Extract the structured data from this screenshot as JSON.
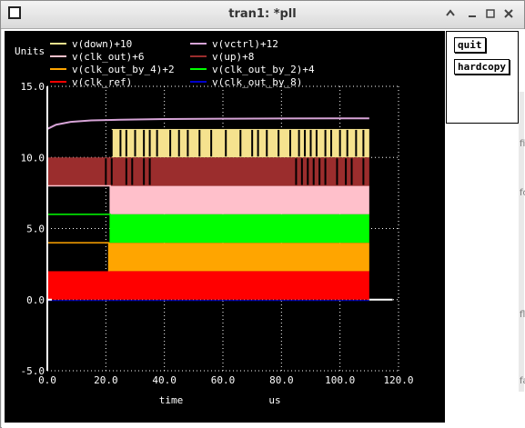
{
  "window": {
    "title": "tran1: *pll"
  },
  "side_buttons": {
    "quit": "quit",
    "hardcopy": "hardcopy"
  },
  "edge_labels": [
    "fi",
    "fo",
    "fl",
    "fa"
  ],
  "colors": {
    "down": "#f5e28e",
    "vctrl": "#d7a4d7",
    "clk_out": "#ffc0cb",
    "up": "#9b2d2d",
    "clk_out_by_4": "#ffa500",
    "clk_out_by_2": "#00ff00",
    "clk_ref": "#ff0000",
    "clk_out_by_8": "#0000cd",
    "axis": "#ffffff",
    "grid": "#ffffff",
    "background": "#000000"
  },
  "chart_data": {
    "type": "line",
    "ylabel": "Units",
    "xlabel": "time",
    "xunit": "us",
    "xlim": [
      0,
      120
    ],
    "ylim": [
      -5,
      15
    ],
    "grid": true,
    "legend_placement": "top",
    "xticks": [
      {
        "v": 0,
        "label": "0.0"
      },
      {
        "v": 20,
        "label": "20.0"
      },
      {
        "v": 40,
        "label": "40.0"
      },
      {
        "v": 60,
        "label": "60.0"
      },
      {
        "v": 80,
        "label": "80.0"
      },
      {
        "v": 100,
        "label": "100.0"
      },
      {
        "v": 120,
        "label": "120.0"
      }
    ],
    "yticks": [
      {
        "v": -5,
        "label": "-5.0"
      },
      {
        "v": 0,
        "label": "0.0"
      },
      {
        "v": 5,
        "label": "5.0"
      },
      {
        "v": 10,
        "label": "10.0"
      },
      {
        "v": 15,
        "label": "15.0"
      }
    ],
    "series": [
      {
        "name": "v(down)+10",
        "color": "#f5e28e",
        "kind": "band",
        "low": 10,
        "high": 12,
        "x_start": 22,
        "x_end": 110,
        "spikes_x": [
          22,
          25,
          27,
          30,
          33,
          35,
          37.5,
          42,
          45,
          48,
          52,
          56,
          61,
          66,
          70,
          72,
          75,
          79,
          83,
          86,
          88,
          90,
          92,
          95,
          97,
          100,
          102.5,
          105.5,
          108
        ]
      },
      {
        "name": "v(vctrl)+12",
        "color": "#d7a4d7",
        "kind": "curve",
        "points": [
          [
            0,
            12
          ],
          [
            3,
            12.3
          ],
          [
            8,
            12.5
          ],
          [
            15,
            12.6
          ],
          [
            25,
            12.65
          ],
          [
            40,
            12.7
          ],
          [
            60,
            12.72
          ],
          [
            80,
            12.74
          ],
          [
            100,
            12.75
          ],
          [
            110,
            12.75
          ]
        ]
      },
      {
        "name": "v(clk_out)+6",
        "color": "#ffc0cb",
        "kind": "band",
        "low": 6,
        "high": 8,
        "x_start": 21.5,
        "x_end": 110
      },
      {
        "name": "v(up)+8",
        "color": "#9b2d2d",
        "kind": "band",
        "low": 8,
        "high": 10,
        "x_start": 0,
        "x_end": 110,
        "spikes_x": [
          20,
          22,
          27,
          29,
          33,
          35,
          85,
          87,
          89,
          91,
          93,
          95,
          99,
          102,
          104,
          108
        ]
      },
      {
        "name": "v(clk_out_by_4)+2",
        "color": "#ffa500",
        "kind": "band",
        "low": 2,
        "high": 4,
        "x_start": 21,
        "x_end": 110
      },
      {
        "name": "v(clk_out_by_2)+4",
        "color": "#00ff00",
        "kind": "band",
        "low": 4,
        "high": 6,
        "x_start": 21.5,
        "x_end": 110
      },
      {
        "name": "v(clk_ref)",
        "color": "#ff0000",
        "kind": "band",
        "low": 0,
        "high": 2,
        "x_start": 0,
        "x_end": 110
      },
      {
        "name": "v(clk_out_by_8)",
        "color": "#0000cd",
        "kind": "flat",
        "level": 0,
        "x_start": 0,
        "x_end": 110
      }
    ]
  }
}
